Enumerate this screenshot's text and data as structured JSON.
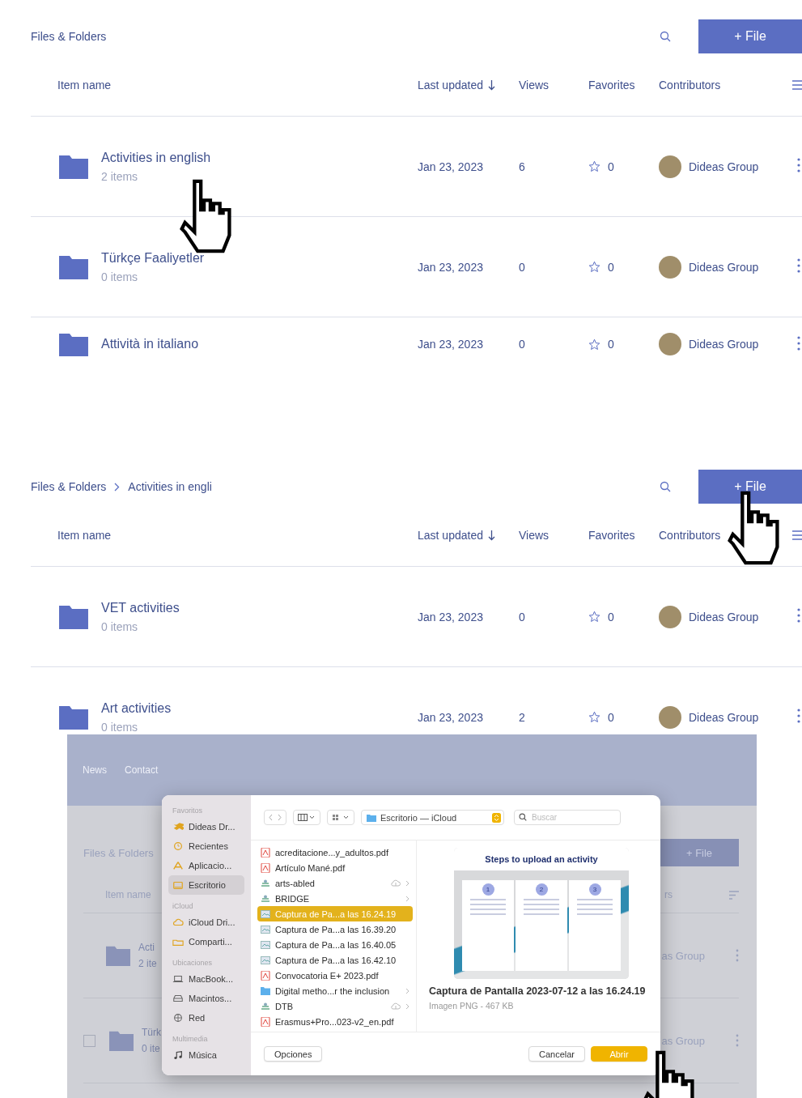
{
  "panels": [
    {
      "breadcrumb": [
        "Files & Folders"
      ],
      "button": "+ File",
      "columns": [
        "Item name",
        "Last updated",
        "Views",
        "Favorites",
        "Contributors"
      ],
      "rows": [
        {
          "name": "Activities in english",
          "sub": "2 items",
          "date": "Jan 23, 2023",
          "views": "6",
          "favorites": "0",
          "contributor": "Dideas Group"
        },
        {
          "name": "Türkçe Faaliyetler",
          "sub": "0 items",
          "date": "Jan 23, 2023",
          "views": "0",
          "favorites": "0",
          "contributor": "Dideas Group"
        },
        {
          "name": "Attività in italiano",
          "date": "Jan 23, 2023",
          "views": "0",
          "favorites": "0",
          "contributor": "Dideas Group"
        }
      ]
    },
    {
      "breadcrumb": [
        "Files & Folders",
        "Activities in engli"
      ],
      "button": "+ File",
      "columns": [
        "Item name",
        "Last updated",
        "Views",
        "Favorites",
        "Contributors"
      ],
      "rows": [
        {
          "name": "VET activities",
          "sub": "0 items",
          "date": "Jan 23, 2023",
          "views": "0",
          "favorites": "0",
          "contributor": "Dideas Group"
        },
        {
          "name": "Art activities",
          "sub": "0 items",
          "date": "Jan 23, 2023",
          "views": "2",
          "favorites": "0",
          "contributor": "Dideas Group"
        }
      ]
    }
  ],
  "dimmed_page": {
    "nav": [
      "News",
      "Contact"
    ],
    "breadcrumb": "Files & Folders",
    "button": "+ File",
    "column": "Item name",
    "column_cut": "rs",
    "rows": [
      {
        "name": "Acti",
        "sub": "2 ite",
        "contributor": "as Group"
      },
      {
        "name": "Türk",
        "sub": "0 ite",
        "contributor": "as Group",
        "checked": false
      }
    ]
  },
  "dialog": {
    "sidebar": [
      {
        "title": "Favoritos",
        "items": [
          {
            "label": "Dideas Dr...",
            "kind": "dropbox",
            "selected": false
          },
          {
            "label": "Recientes",
            "kind": "clock",
            "selected": false
          },
          {
            "label": "Aplicacio...",
            "kind": "apps",
            "selected": false
          },
          {
            "label": "Escritorio",
            "kind": "desktop",
            "selected": true
          }
        ]
      },
      {
        "title": "iCloud",
        "items": [
          {
            "label": "iCloud Dri...",
            "kind": "cloud",
            "selected": false
          },
          {
            "label": "Comparti...",
            "kind": "shared",
            "selected": false
          }
        ]
      },
      {
        "title": "Ubicaciones",
        "items": [
          {
            "label": "MacBook...",
            "kind": "laptop",
            "selected": false
          },
          {
            "label": "Macintos...",
            "kind": "disk",
            "selected": false
          },
          {
            "label": "Red",
            "kind": "network",
            "selected": false
          }
        ]
      },
      {
        "title": "Multimedia",
        "items": [
          {
            "label": "Música",
            "kind": "music",
            "selected": false
          }
        ]
      }
    ],
    "location": "Escritorio — iCloud",
    "search": {
      "placeholder": "Buscar"
    },
    "files": [
      {
        "name": "acreditacione...y_adultos.pdf",
        "kind": "pdf",
        "selected": false,
        "cloud": false,
        "expandable": false
      },
      {
        "name": "Artículo Mané.pdf",
        "kind": "pdf",
        "selected": false,
        "cloud": false,
        "expandable": false
      },
      {
        "name": "arts-abled",
        "kind": "app",
        "selected": false,
        "cloud": true,
        "expandable": true
      },
      {
        "name": "BRIDGE",
        "kind": "app",
        "selected": false,
        "cloud": false,
        "expandable": true
      },
      {
        "name": "Captura de Pa...a las 16.24.19",
        "kind": "image",
        "selected": true,
        "cloud": false,
        "expandable": false
      },
      {
        "name": "Captura de Pa...a las 16.39.20",
        "kind": "image",
        "selected": false,
        "cloud": false,
        "expandable": false
      },
      {
        "name": "Captura de Pa...a las 16.40.05",
        "kind": "image",
        "selected": false,
        "cloud": false,
        "expandable": false
      },
      {
        "name": "Captura de Pa...a las 16.42.10",
        "kind": "image",
        "selected": false,
        "cloud": false,
        "expandable": false
      },
      {
        "name": "Convocatoria E+ 2023.pdf",
        "kind": "pdf",
        "selected": false,
        "cloud": false,
        "expandable": false
      },
      {
        "name": "Digital metho...r the inclusion",
        "kind": "folder",
        "selected": false,
        "cloud": false,
        "expandable": true
      },
      {
        "name": "DTB",
        "kind": "app",
        "selected": false,
        "cloud": true,
        "expandable": true
      },
      {
        "name": "Erasmus+Pro...023-v2_en.pdf",
        "kind": "pdf",
        "selected": false,
        "cloud": false,
        "expandable": false
      }
    ],
    "preview": {
      "thumbnail_title": "Steps to upload an activity",
      "steps": [
        "1",
        "2",
        "3"
      ],
      "name": "Captura de Pantalla 2023-07-12 a las 16.24.19",
      "info": "Imagen PNG - 467 KB"
    },
    "buttons": {
      "options": "Opciones",
      "cancel": "Cancelar",
      "open": "Abrir"
    }
  }
}
